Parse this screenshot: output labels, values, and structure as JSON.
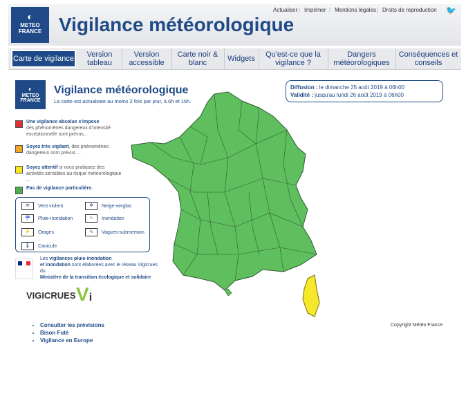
{
  "header": {
    "logo_text": [
      "METEO",
      "FRANCE"
    ],
    "title": "Vigilance météorologique",
    "utility_links": [
      "Actualiser",
      "Imprimer",
      "Mentions légales",
      "Droits de reproduction"
    ]
  },
  "nav": {
    "tabs": [
      {
        "label": "Carte de vigilance",
        "active": true
      },
      {
        "label": "Version tableau"
      },
      {
        "label": "Version accessible"
      },
      {
        "label": "Carte noir & blanc"
      },
      {
        "label": "Widgets"
      },
      {
        "label": "Qu'est-ce que la vigilance ?"
      },
      {
        "label": "Dangers météorologiques"
      },
      {
        "label": "Conséquences et conseils"
      }
    ]
  },
  "panel": {
    "title": "Vigilance météorologique",
    "subtitle": "La carte est actualisée au moins 2 fois par jour, à 6h et 16h.",
    "diffusion_label": "Diffusion :",
    "diffusion_value": "le dimanche 25 août 2019 à 06h00",
    "validite_label": "Validité :",
    "validite_value": "jusqu'au lundi 26 août 2019 à 06h00"
  },
  "legend": [
    {
      "color": "#e03131",
      "bold": "Une vigilance absolue s'impose",
      "text": "des phénomènes dangereux d'intensité exceptionnelle sont prévus..."
    },
    {
      "color": "#f5a623",
      "bold": "Soyez très vigilant",
      "text": ", des phénomènes dangereux sont prévus ..."
    },
    {
      "color": "#f8e71c",
      "bold": "Soyez attentif",
      "text": " si vous pratiquez des activités sensibles au risque météorologique ..."
    },
    {
      "color": "#4caf50",
      "bold": "Pas de vigilance particulière.",
      "text": ""
    }
  ],
  "phenomena": [
    "Vent violent",
    "Neige-verglas",
    "Pluie-inondation",
    "Inondation",
    "Orages",
    "Vagues-submersion",
    "Canicule"
  ],
  "partner": {
    "prefix": "Les ",
    "bold1": "vigilances pluie-inondation",
    "mid1": " et inondation",
    "mid2": " sont élaborées avec le réseau Vigicrues du",
    "bold2": "Ministère de la transition écologique et solidaire"
  },
  "vigicrues": "VIGICRUES",
  "links": [
    "Consulter les prévisions",
    "Bison Futé",
    "Vigilance en Europe"
  ],
  "copyright": "Copyright Météo France",
  "colors": {
    "green": "#5fbf5f",
    "yellow": "#f5e82a",
    "brand": "#1f4a87"
  }
}
